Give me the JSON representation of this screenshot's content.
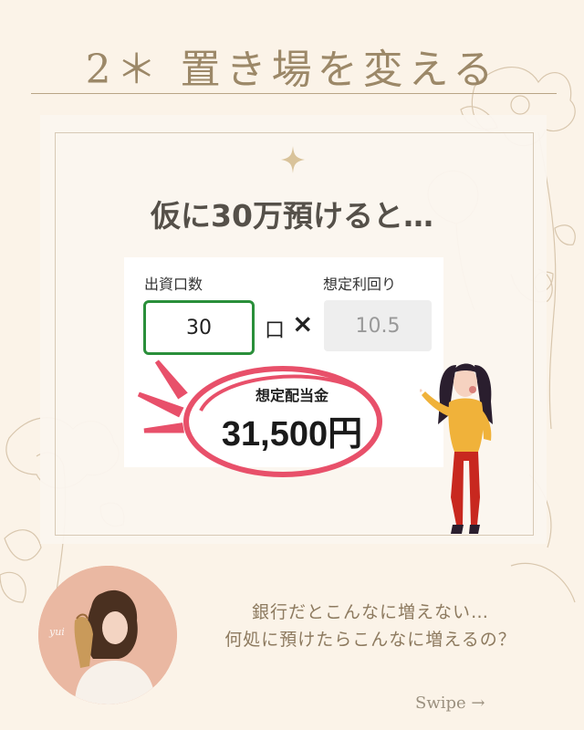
{
  "header": {
    "title": "2＊ 置き場を変える"
  },
  "main": {
    "lead": "仮に30万預けると…",
    "calculator": {
      "units_label": "出資口数",
      "units_value": "30",
      "units_suffix": "口",
      "times_symbol": "×",
      "rate_label": "想定利回り",
      "rate_value": "10.5",
      "dividend_label": "想定配当金",
      "dividend_value": "31,500円"
    }
  },
  "footer": {
    "speech_line1": "銀行だとこんなに増えない…",
    "speech_line2": "何処に預けたらこんなに増えるの？",
    "swipe": "Swipe →",
    "avatar_signature": "yui"
  },
  "colors": {
    "background": "#fbf3e8",
    "accent_brown": "#9c8868",
    "input_border_green": "#2a8f3a",
    "highlight_pink": "#e8506a",
    "woman_sweater": "#f0b23a",
    "woman_pants": "#c8281f"
  },
  "icons": [
    "sparkle-icon",
    "times-icon",
    "burst-lines-icon",
    "arrow-right-icon"
  ]
}
